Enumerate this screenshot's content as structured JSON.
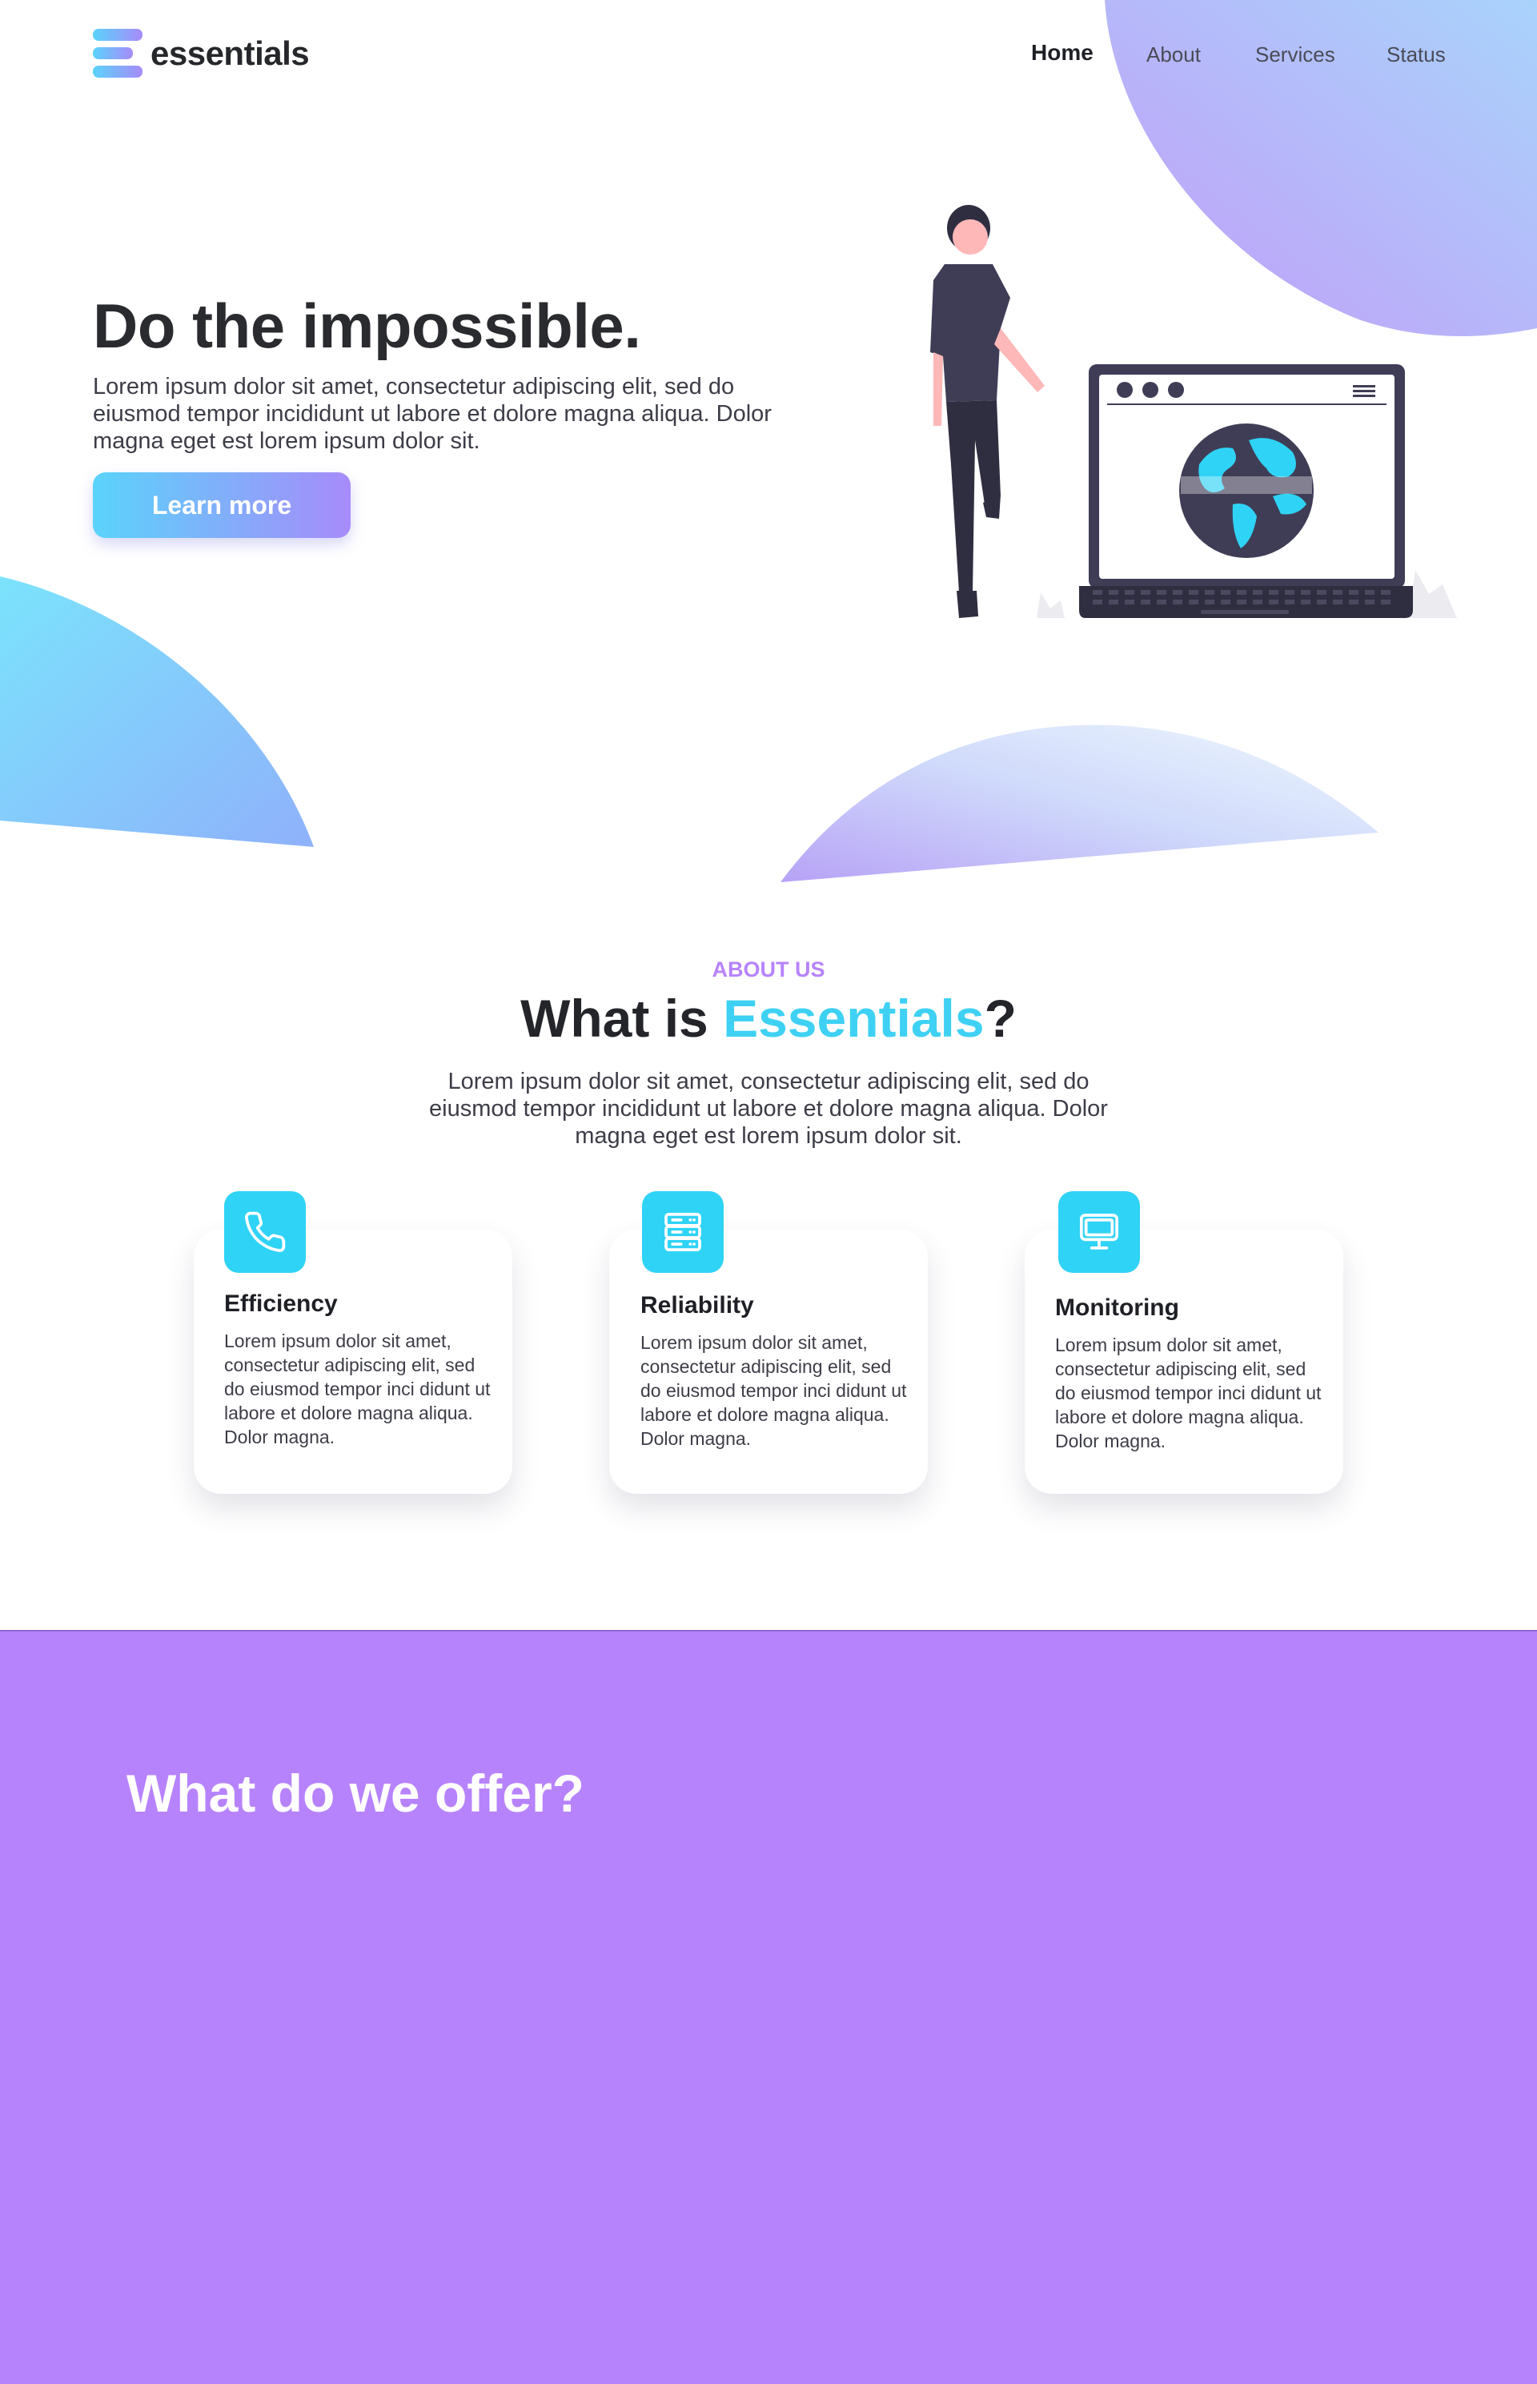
{
  "header": {
    "logo_text": "essentials",
    "nav": [
      {
        "label": "Home",
        "active": true
      },
      {
        "label": "About",
        "active": false
      },
      {
        "label": "Services",
        "active": false
      },
      {
        "label": "Status",
        "active": false
      }
    ]
  },
  "hero": {
    "title": "Do the impossible.",
    "text": "Lorem ipsum dolor sit amet, consectetur adipiscing elit, sed do eiusmod tempor incididunt ut labore et dolore magna aliqua. Dolor magna eget est lorem ipsum dolor sit.",
    "button_label": "Learn more"
  },
  "about": {
    "kicker": "ABOUT US",
    "title_prefix": "What is ",
    "title_accent": "Essentials",
    "title_suffix": "?",
    "text": "Lorem ipsum dolor sit amet, consectetur adipiscing elit, sed do eiusmod tempor incididunt ut labore et dolore magna aliqua. Dolor magna eget est lorem ipsum dolor sit.",
    "cards": [
      {
        "title": "Efficiency",
        "icon": "phone-icon",
        "text": "Lorem ipsum dolor sit amet, consectetur adipiscing elit, sed do eiusmod tempor inci didunt ut labore et dolore magna aliqua. Dolor magna."
      },
      {
        "title": "Reliability",
        "icon": "server-icon",
        "text": "Lorem ipsum dolor sit amet, consectetur adipiscing elit, sed do eiusmod tempor inci didunt ut labore et dolore magna aliqua. Dolor magna."
      },
      {
        "title": "Monitoring",
        "icon": "monitor-icon",
        "text": "Lorem ipsum dolor sit amet, consectetur adipiscing elit, sed do eiusmod tempor inci didunt ut labore et dolore magna aliqua. Dolor magna."
      }
    ]
  },
  "offer": {
    "title": "What do we offer?"
  },
  "colors": {
    "accent_cyan": "#3ed1f3",
    "accent_purple": "#b783fc",
    "text_dark": "#26272b"
  }
}
